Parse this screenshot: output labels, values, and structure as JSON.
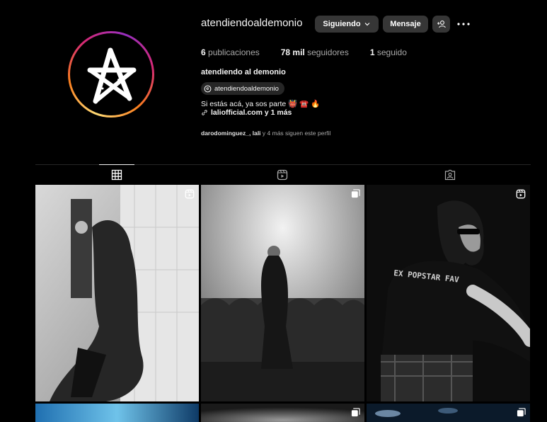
{
  "profile": {
    "username": "atendiendoaldemonio",
    "full_name": "atendiendo al demonio",
    "threads_handle": "atendiendoaldemonio",
    "bio": "Si estás acá, ya sos parte 👹 ☎️ 🔥",
    "link": "laliofficial.com y 1 más",
    "followed_by": {
      "names": "darodominguez_, lali",
      "suffix": " y 4 más siguen este perfil"
    }
  },
  "actions": {
    "follow_label": "Siguiendo",
    "message_label": "Mensaje"
  },
  "stats": {
    "posts_count": "6",
    "posts_label": " publicaciones",
    "followers_count": "78 mil",
    "followers_label": " seguidores",
    "following_count": "1",
    "following_label": " seguido"
  },
  "tabs": [
    {
      "name": "posts",
      "icon": "grid-icon",
      "active": true
    },
    {
      "name": "reels",
      "icon": "reels-icon",
      "active": false
    },
    {
      "name": "tagged",
      "icon": "tagged-icon",
      "active": false
    }
  ],
  "posts": [
    {
      "type": "reel",
      "icon": "reel-icon"
    },
    {
      "type": "carousel",
      "icon": "carousel-icon"
    },
    {
      "type": "reel",
      "icon": "reel-icon"
    },
    {
      "type": "image"
    },
    {
      "type": "carousel",
      "icon": "carousel-icon"
    },
    {
      "type": "carousel",
      "icon": "carousel-icon"
    }
  ],
  "colors": {
    "background": "#000000",
    "button": "#363636",
    "ring_gradient": [
      "#feda75",
      "#fa7e1e",
      "#d62976",
      "#962fbf"
    ]
  }
}
